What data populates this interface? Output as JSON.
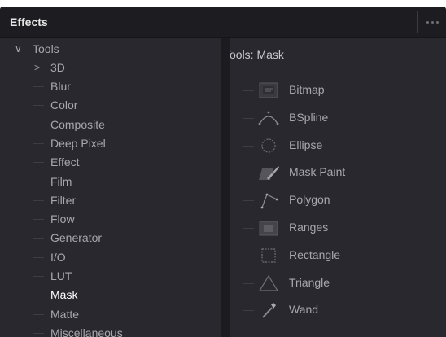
{
  "panel": {
    "title": "Effects"
  },
  "tree": {
    "root": "Tools",
    "child_3d": "3D",
    "items": [
      "Blur",
      "Color",
      "Composite",
      "Deep Pixel",
      "Effect",
      "Film",
      "Filter",
      "Flow",
      "Generator",
      "I/O",
      "LUT",
      "Mask",
      "Matte",
      "Miscellaneous"
    ],
    "selected": "Mask"
  },
  "tools_panel": {
    "title": "Tools: Mask",
    "tools": [
      {
        "label": "Bitmap",
        "icon": "bitmap-icon"
      },
      {
        "label": "BSpline",
        "icon": "bspline-icon"
      },
      {
        "label": "Ellipse",
        "icon": "ellipse-icon"
      },
      {
        "label": "Mask Paint",
        "icon": "mask-paint-icon"
      },
      {
        "label": "Polygon",
        "icon": "polygon-icon"
      },
      {
        "label": "Ranges",
        "icon": "ranges-icon"
      },
      {
        "label": "Rectangle",
        "icon": "rectangle-icon"
      },
      {
        "label": "Triangle",
        "icon": "triangle-icon"
      },
      {
        "label": "Wand",
        "icon": "wand-icon"
      }
    ]
  },
  "colors": {
    "panel_bg": "#28282e",
    "header_bg": "#1d1d21",
    "text": "#a8a8ac",
    "text_selected": "#ffffff"
  }
}
